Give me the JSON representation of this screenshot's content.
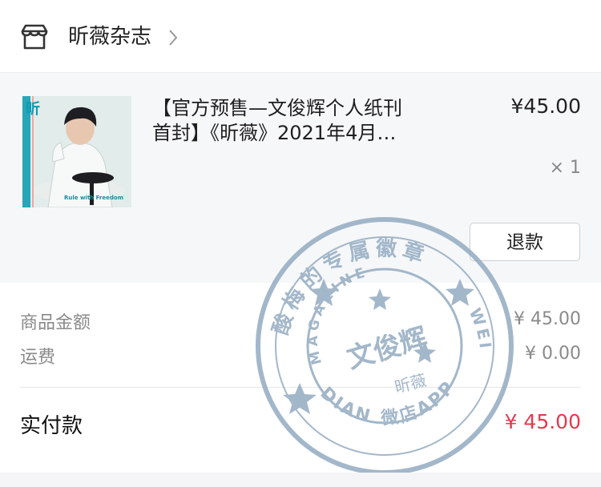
{
  "shop": {
    "name": "昕薇杂志",
    "icon": "store-icon"
  },
  "product": {
    "title_line1": "【官方预售—文俊辉个人纸刊",
    "title_line2": "首封】《昕薇》2021年4月…",
    "price": "¥45.00",
    "quantity": "× 1",
    "refund_label": "退款",
    "cover_masthead": "昕",
    "cover_caption": "Rule with Freedom"
  },
  "summary": {
    "goods_amount_label": "商品金额",
    "goods_amount_value": "¥ 45.00",
    "shipping_label": "运费",
    "shipping_value": "¥ 0.00",
    "total_label": "实付款",
    "total_value": "¥ 45.00"
  },
  "stamp": {
    "ring_text": "酸梅的专属徽章",
    "magazine": "MAGAZINE",
    "name": "文俊辉",
    "logo": "昕薇",
    "dian": "DIAN",
    "wei": "WEI",
    "shop": "微店APP",
    "color": "#8fa8bf"
  },
  "colors": {
    "total_accent": "#e8384e",
    "background": "#f5f5f7"
  }
}
